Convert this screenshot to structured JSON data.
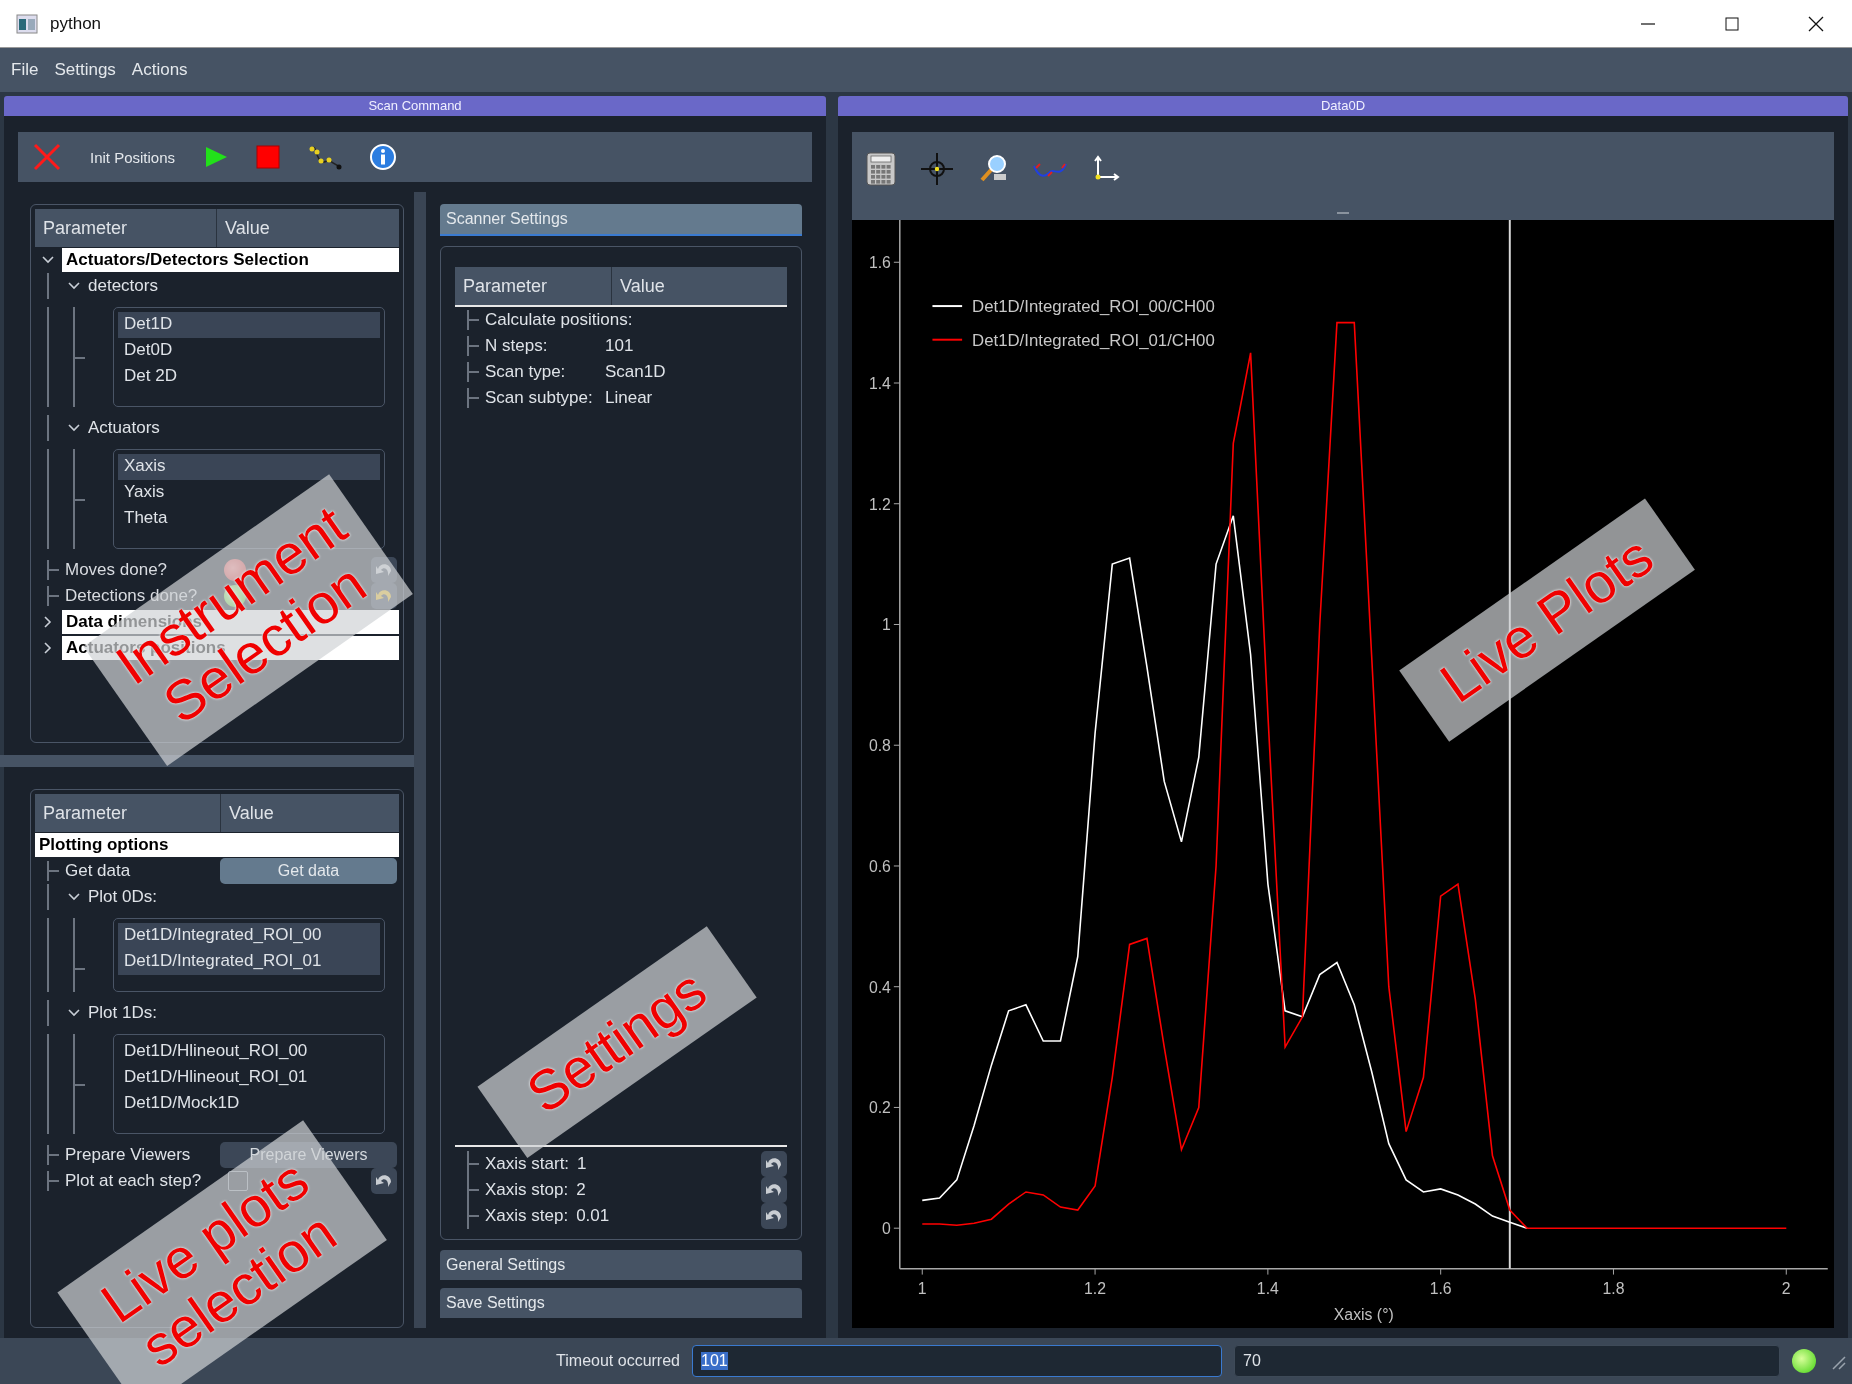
{
  "window": {
    "title": "python"
  },
  "menu": [
    "File",
    "Settings",
    "Actions"
  ],
  "scan_dock": {
    "title": "Scan Command",
    "toolbar": [
      {
        "kind": "quit"
      },
      {
        "kind": "text",
        "label": "Init Positions"
      },
      {
        "kind": "start"
      },
      {
        "kind": "stop"
      },
      {
        "kind": "path"
      },
      {
        "kind": "info"
      }
    ],
    "selection_tree": {
      "columns": [
        "Parameter",
        "Value"
      ],
      "nodes": [
        {
          "kind": "group",
          "label": "Actuators/Detectors Selection",
          "expanded": true,
          "children": [
            {
              "kind": "branch",
              "label": "detectors",
              "expanded": true,
              "children": [
                {
                  "kind": "list",
                  "items": [
                    {
                      "label": "Det1D",
                      "selected": true
                    },
                    {
                      "label": "Det0D",
                      "selected": false
                    },
                    {
                      "label": "Det 2D",
                      "selected": false
                    }
                  ]
                }
              ]
            },
            {
              "kind": "branch",
              "label": "Actuators",
              "expanded": true,
              "children": [
                {
                  "kind": "list",
                  "items": [
                    {
                      "label": "Xaxis",
                      "selected": true
                    },
                    {
                      "label": "Yaxis",
                      "selected": false
                    },
                    {
                      "label": "Theta",
                      "selected": false
                    }
                  ]
                }
              ]
            },
            {
              "kind": "led",
              "label": "Moves done?",
              "on": false,
              "modified": false
            },
            {
              "kind": "led",
              "label": "Detections done?",
              "on": true,
              "modified": true
            }
          ]
        },
        {
          "kind": "group",
          "label": "Data dimensions",
          "expanded": false
        },
        {
          "kind": "group",
          "label": "Actuators positions",
          "expanded": false
        }
      ]
    },
    "plot_tree": {
      "columns": [
        "Parameter",
        "Value"
      ],
      "nodes": [
        {
          "kind": "group",
          "label": "Plotting options",
          "children": [
            {
              "kind": "button",
              "label": "Get data",
              "button": "Get data",
              "enabled": true
            },
            {
              "kind": "branch",
              "label": "Plot 0Ds:",
              "expanded": true,
              "children": [
                {
                  "kind": "list",
                  "items": [
                    {
                      "label": "Det1D/Integrated_ROI_00",
                      "selected": true
                    },
                    {
                      "label": "Det1D/Integrated_ROI_01",
                      "selected": true
                    }
                  ]
                }
              ]
            },
            {
              "kind": "branch",
              "label": "Plot 1Ds:",
              "expanded": true,
              "children": [
                {
                  "kind": "list",
                  "items": [
                    {
                      "label": "Det1D/Hlineout_ROI_00",
                      "selected": false
                    },
                    {
                      "label": "Det1D/Hlineout_ROI_01",
                      "selected": false
                    },
                    {
                      "label": "Det1D/Mock1D",
                      "selected": false
                    }
                  ]
                }
              ]
            },
            {
              "kind": "button",
              "label": "Prepare Viewers",
              "button": "Prepare Viewers",
              "enabled": false
            },
            {
              "kind": "check",
              "label": "Plot at each step?",
              "checked": false,
              "modified": false
            }
          ]
        }
      ]
    },
    "scanner": {
      "tabs": [
        {
          "label": "Scanner Settings",
          "selected": true
        },
        {
          "label": "General Settings",
          "selected": false
        },
        {
          "label": "Save Settings",
          "selected": false
        }
      ],
      "columns": [
        "Parameter",
        "Value"
      ],
      "params": [
        {
          "kind": "value",
          "label": "Calculate positions:"
        },
        {
          "kind": "value",
          "label": "N steps:",
          "value": "101"
        },
        {
          "kind": "value",
          "label": "Scan type:",
          "value": "Scan1D"
        },
        {
          "kind": "value",
          "label": "Scan subtype:",
          "value": "Linear"
        }
      ],
      "axis_params": [
        {
          "kind": "inline",
          "label": "Xaxis start:",
          "value": "1",
          "modified": false
        },
        {
          "kind": "inline",
          "label": "Xaxis stop:",
          "value": "2",
          "modified": false
        },
        {
          "kind": "inline",
          "label": "Xaxis step:",
          "value": "0.01",
          "modified": false
        }
      ]
    }
  },
  "plot_dock": {
    "title": "Data0D",
    "toolbar": [
      {
        "kind": "calculator"
      },
      {
        "kind": "crosshair"
      },
      {
        "kind": "zoom"
      },
      {
        "kind": "fit"
      },
      {
        "kind": "axes"
      }
    ],
    "chart_data": {
      "type": "line",
      "xlabel": "Xaxis (°)",
      "xlim": [
        0.974,
        2.048
      ],
      "ylim": [
        -0.067,
        1.67
      ],
      "xticks": [
        1,
        1.2,
        1.4,
        1.6,
        1.8,
        2
      ],
      "yticks": [
        0,
        0.2,
        0.4,
        0.6,
        0.8,
        1,
        1.2,
        1.4,
        1.6
      ],
      "x": [
        1,
        1.02,
        1.04,
        1.06,
        1.08,
        1.1,
        1.12,
        1.14,
        1.16,
        1.18,
        1.2,
        1.22,
        1.24,
        1.26,
        1.28,
        1.3,
        1.32,
        1.34,
        1.36,
        1.38,
        1.4,
        1.42,
        1.44,
        1.46,
        1.48,
        1.5,
        1.52,
        1.54,
        1.56,
        1.58,
        1.6,
        1.62,
        1.64,
        1.66,
        1.68,
        1.7,
        1.72,
        1.74,
        1.76,
        1.78,
        1.8,
        1.82,
        1.84,
        1.86,
        1.88,
        1.9,
        1.92,
        1.94,
        1.96,
        1.98,
        2
      ],
      "series": [
        {
          "name": "Det1D/Integrated_ROI_00/CH00",
          "color": "#ffffff",
          "values": [
            0.046,
            0.05,
            0.08,
            0.17,
            0.27,
            0.36,
            0.37,
            0.31,
            0.31,
            0.45,
            0.82,
            1.1,
            1.11,
            0.93,
            0.74,
            0.64,
            0.78,
            1.1,
            1.18,
            0.95,
            0.57,
            0.36,
            0.35,
            0.42,
            0.44,
            0.37,
            0.26,
            0.14,
            0.08,
            0.06,
            0.065,
            0.055,
            0.04,
            0.02,
            0.01,
            0,
            null,
            null,
            null,
            null,
            null,
            null,
            null,
            null,
            null,
            null,
            null,
            null,
            null,
            null,
            null
          ]
        },
        {
          "name": "Det1D/Integrated_ROI_01/CH00",
          "color": "#ff0000",
          "values": [
            0.007,
            0.007,
            0.005,
            0.008,
            0.015,
            0.04,
            0.06,
            0.055,
            0.035,
            0.03,
            0.07,
            0.25,
            0.47,
            0.48,
            0.3,
            0.13,
            0.2,
            0.6,
            1.3,
            1.45,
            0.85,
            0.3,
            0.35,
            1.0,
            1.5,
            1.5,
            0.95,
            0.4,
            0.16,
            0.25,
            0.55,
            0.57,
            0.38,
            0.12,
            0.03,
            0,
            0,
            0,
            0,
            0,
            0,
            0,
            0,
            0,
            0,
            0,
            0,
            0,
            0,
            0,
            0
          ]
        }
      ],
      "legend": "upper left",
      "ref_lines": [
        {
          "axis": "x",
          "value": 1.68
        }
      ]
    }
  },
  "status_bar": {
    "message": "Timeout occurred",
    "fields": [
      {
        "value": "101",
        "text_selected": true
      },
      {
        "value": "70",
        "text_selected": false
      }
    ],
    "led_on": true
  },
  "annotations": [
    {
      "text": "Instrument Selection"
    },
    {
      "text": "Settings"
    },
    {
      "text": "Live Plots"
    },
    {
      "text": "Live plots selection"
    }
  ]
}
